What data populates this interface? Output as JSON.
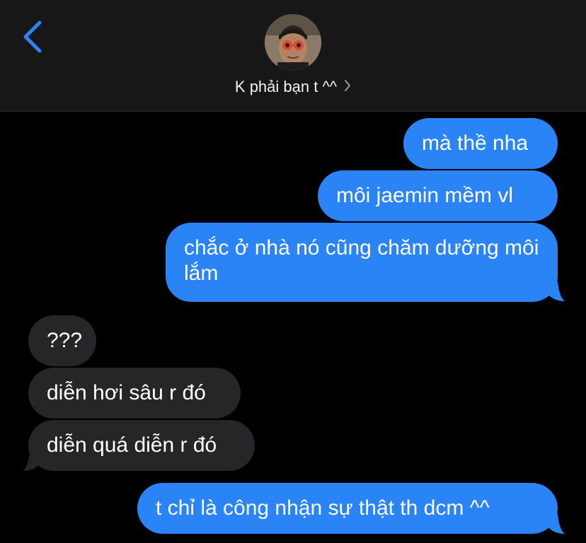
{
  "header": {
    "contact_name": "K phải bạn t ^^",
    "chevron": "›",
    "icons": {
      "back": "chevron-left-icon",
      "avatar": "contact-avatar"
    },
    "accent_color": "#2B84F6"
  },
  "messages": [
    {
      "direction": "sent",
      "text": "mà thề nha"
    },
    {
      "direction": "sent",
      "text": "môi jaemin mềm vl"
    },
    {
      "direction": "sent",
      "text": "chắc ở nhà nó cũng chăm dưỡng môi lắm"
    },
    {
      "direction": "received",
      "text": "???"
    },
    {
      "direction": "received",
      "text": "diễn hơi sâu r đó"
    },
    {
      "direction": "received",
      "text": "diễn quá diễn r đó"
    },
    {
      "direction": "sent",
      "text": "t chỉ là công nhận sự thật th dcm ^^"
    }
  ],
  "colors": {
    "sent_bubble": "#2B84F6",
    "received_bubble": "#262628",
    "background": "#000000"
  }
}
